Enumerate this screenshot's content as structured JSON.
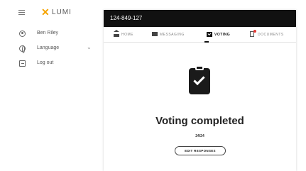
{
  "app": {
    "brand": "LUMI",
    "brand_color": "#f5a300"
  },
  "sidebar": {
    "items": [
      {
        "label": "Ben Riley",
        "icon": "user-icon"
      },
      {
        "label": "Language",
        "icon": "globe-icon"
      },
      {
        "label": "Log out",
        "icon": "logout-icon"
      }
    ]
  },
  "header": {
    "meeting_id": "124-849-127"
  },
  "tabs": [
    {
      "label": "HOME",
      "icon": "home-icon",
      "active": false
    },
    {
      "label": "MESSAGING",
      "icon": "messaging-icon",
      "active": false
    },
    {
      "label": "VOTING",
      "icon": "voting-icon",
      "active": true
    },
    {
      "label": "DOCUMENTS",
      "icon": "documents-icon",
      "active": false
    }
  ],
  "main": {
    "status_icon": "clipboard-check-icon",
    "title": "Voting completed",
    "count": "24/24",
    "edit_button": "EDIT RESPONSES"
  }
}
